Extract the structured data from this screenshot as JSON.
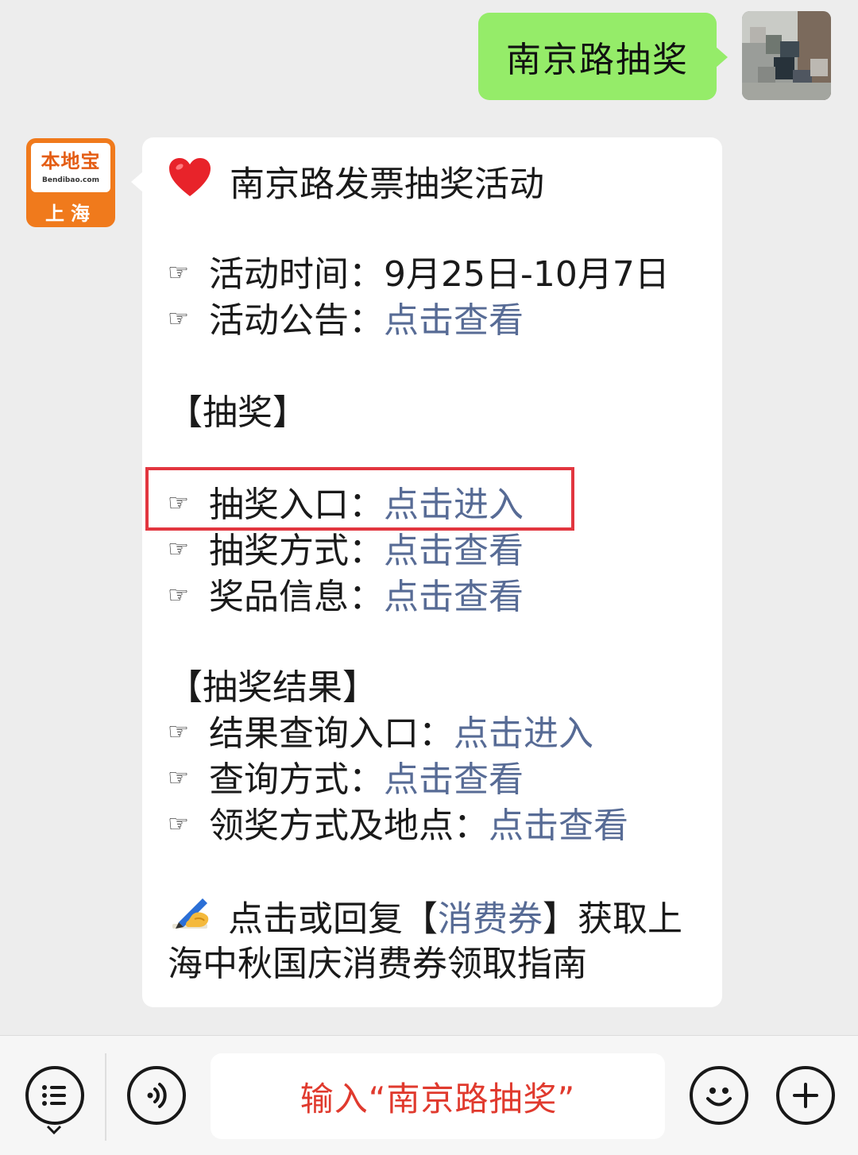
{
  "outgoing": {
    "text": "南京路抽奖"
  },
  "brand": {
    "name": "本地宝",
    "domain": "Bendibao.com",
    "city": "上海"
  },
  "message": {
    "title": "南京路发票抽奖活动",
    "time_label": "活动时间：",
    "time_value": "9月25日-10月7日",
    "notice_label": "活动公告：",
    "notice_link": "点击查看",
    "section_draw": "【抽奖】",
    "entry_label": "抽奖入口：",
    "entry_link": "点击进入",
    "method_label": "抽奖方式：",
    "method_link": "点击查看",
    "prize_label": "奖品信息：",
    "prize_link": "点击查看",
    "section_result": "【抽奖结果】",
    "result_entry_label": "结果查询入口：",
    "result_entry_link": "点击进入",
    "query_label": "查询方式：",
    "query_link": "点击查看",
    "claim_label": "领奖方式及地点：",
    "claim_link": "点击查看",
    "footer_pre": "点击或回复【",
    "footer_link": "消费券",
    "footer_post": "】获取上",
    "footer_line2": "海中秋国庆消费券领取指南"
  },
  "input_bar": {
    "text": "输入“南京路抽奖”"
  },
  "icons": {
    "hand": "☞",
    "heart": "heart-icon",
    "pen": "writing-hand-icon"
  },
  "colors": {
    "link": "#576b95",
    "outgoing": "#95ec69",
    "highlight": "#e2363f",
    "input_text": "#e03a2e"
  }
}
